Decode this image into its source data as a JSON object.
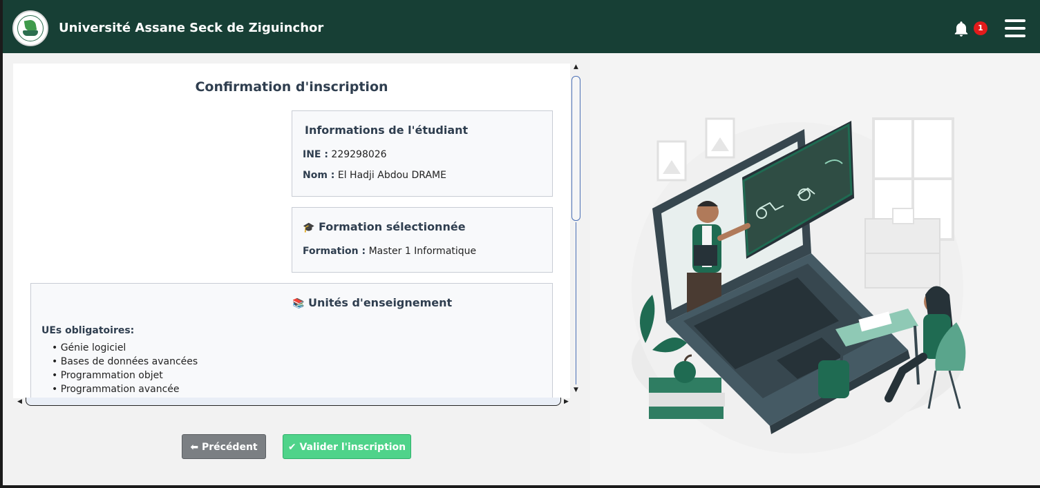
{
  "header": {
    "app_title": "Université Assane Seck de Ziguinchor",
    "notification_count": "1",
    "bell_icon": "bell-icon",
    "menu_icon": "hamburger-menu-icon"
  },
  "card": {
    "title": "Confirmation d'inscription",
    "student": {
      "title": "Informations de l'étudiant",
      "ine_label": "INE :",
      "ine_value": "229298026",
      "nom_label": "Nom :",
      "nom_value": "El Hadji Abdou DRAME"
    },
    "formation": {
      "icon": "🎓",
      "title": "Formation sélectionnée",
      "label": "Formation :",
      "value": "Master 1 Informatique"
    },
    "ues": {
      "icon": "📚",
      "title": "Unités d'enseignement",
      "obligatoires_label": "UEs obligatoires:",
      "items": [
        "• Génie logiciel",
        "• Bases de données avancées",
        "• Programmation objet",
        "• Programmation avancée"
      ]
    }
  },
  "buttons": {
    "prev": "⬅ Précédent",
    "validate": "✔ Valider l'inscription"
  },
  "colors": {
    "header_bg": "#173f35",
    "badge": "#e21b1b",
    "validate_btn": "#4fd38a",
    "prev_btn": "#7b7f83"
  }
}
